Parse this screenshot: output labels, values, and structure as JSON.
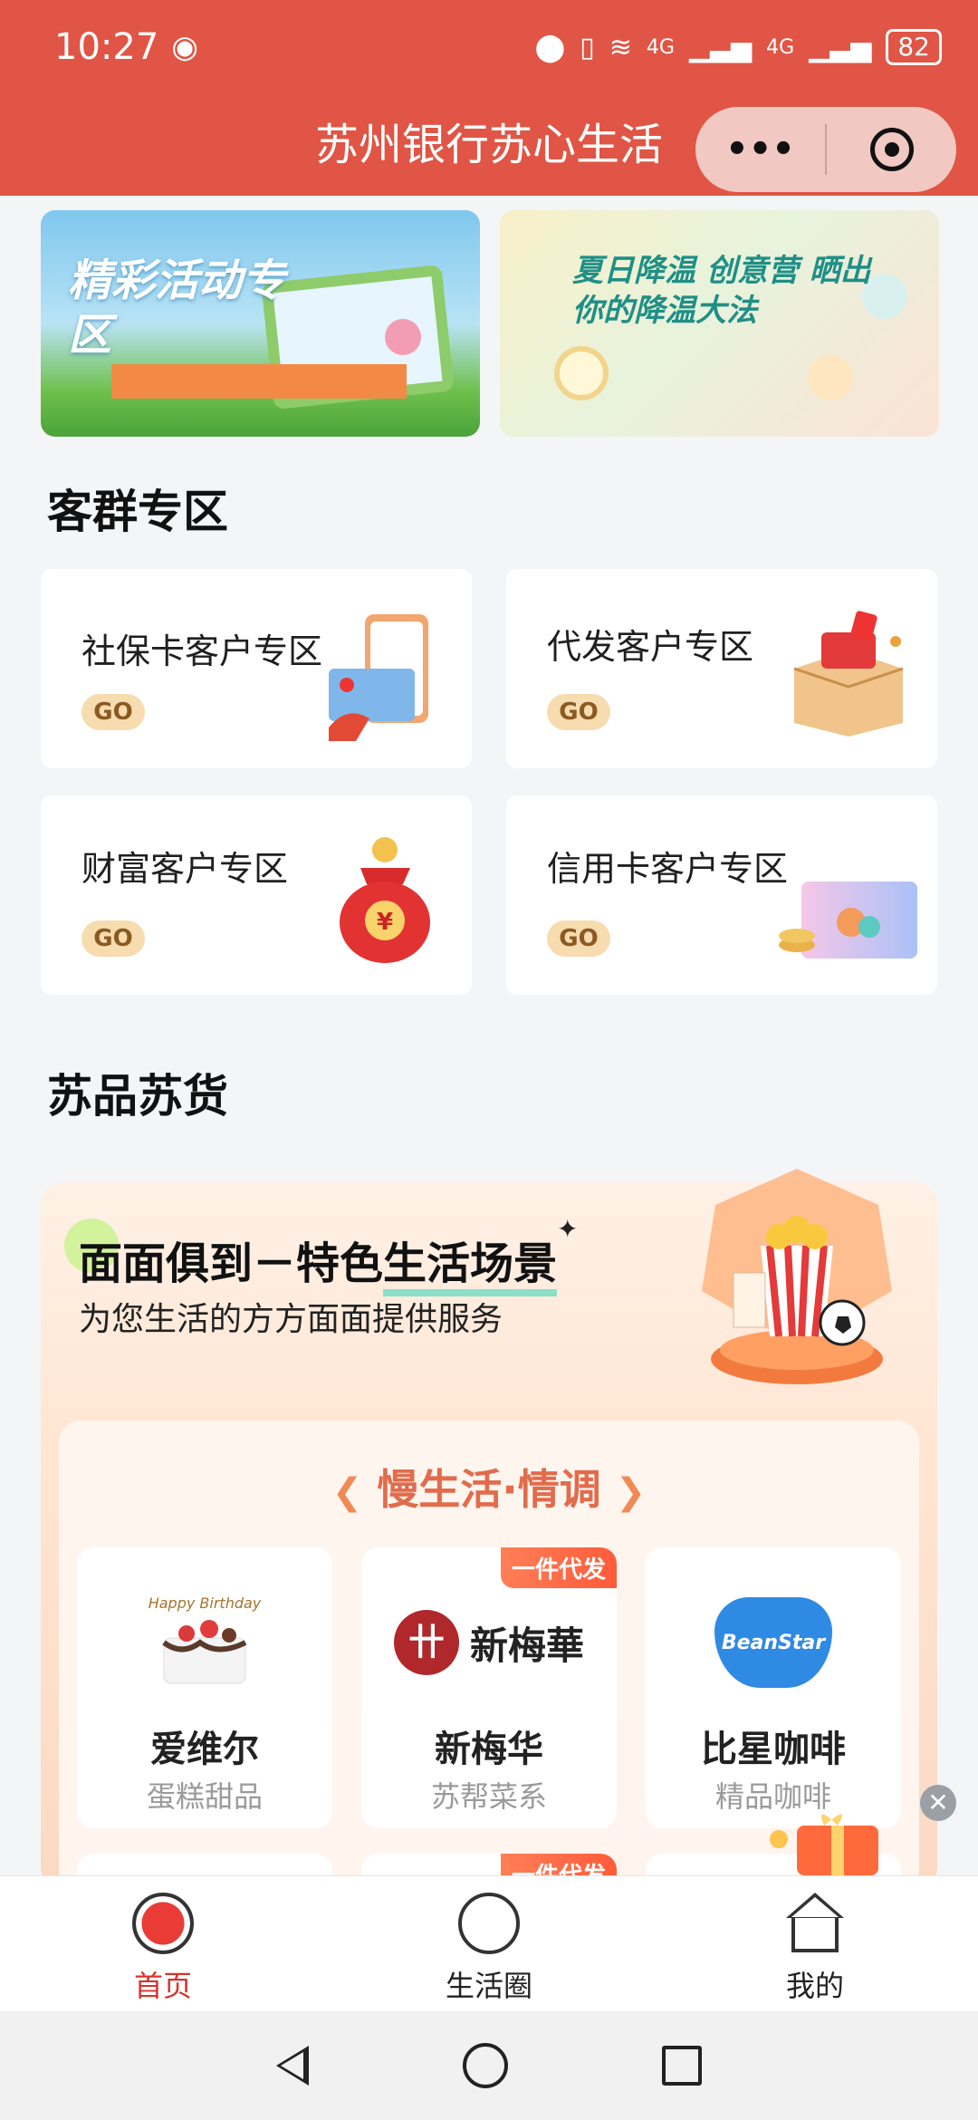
{
  "status_bar": {
    "time": "10:27",
    "network_a": "4G",
    "network_b": "4G",
    "battery": "82"
  },
  "header": {
    "title": "苏州银行苏心生活",
    "more_icon": "more-dots-icon",
    "close_icon": "target-icon"
  },
  "banners": [
    {
      "text": "精彩活动专区"
    },
    {
      "text": "夏日降温 创意营 晒出你的降温大法"
    }
  ],
  "customer_section": {
    "title": "客群专区",
    "cards": [
      {
        "label": "社保卡客户专区",
        "go": "GO"
      },
      {
        "label": "代发客户专区",
        "go": "GO"
      },
      {
        "label": "财富客户专区",
        "go": "GO",
        "icon": "¥"
      },
      {
        "label": "信用卡客户专区",
        "go": "GO"
      }
    ]
  },
  "goods_section": {
    "title": "苏品苏货",
    "panel_title_a": "面面俱到－特色",
    "panel_title_b": "生活场景",
    "panel_subtitle": "为您生活的方方面面提供服务",
    "inner_title": "慢生活·情调",
    "products": [
      {
        "name": "爱维尔",
        "sub": "蛋糕甜品",
        "logo_text": "Happy Birthday"
      },
      {
        "name": "新梅华",
        "sub": "苏帮菜系",
        "tag": "一件代发",
        "logo_text": "新梅華"
      },
      {
        "name": "比星咖啡",
        "sub": "精品咖啡",
        "logo_text": "BeanStar"
      }
    ],
    "next_row_tag": "一件代发"
  },
  "tabbar": [
    {
      "label": "首页",
      "active": true
    },
    {
      "label": "生活圈",
      "active": false
    },
    {
      "label": "我的",
      "active": false
    }
  ],
  "colors": {
    "brand": "#e05545",
    "tab_active": "#d7322d",
    "go_bg": "#f7dcb0"
  }
}
